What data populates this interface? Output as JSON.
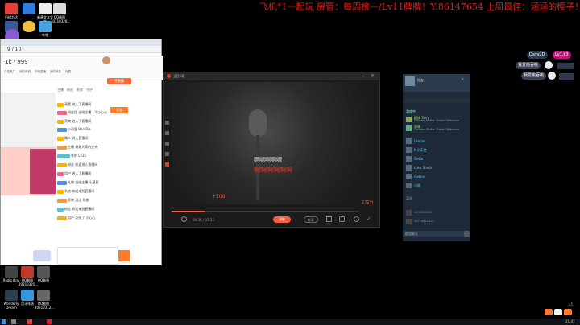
{
  "marquee": {
    "text": "飞机*1一起玩 房管：每周榜一/Lv11牌牌！Y:86147654 上周最佳：涵涵的樱子！"
  },
  "desktop_icons": [
    {
      "label": "扫描方达"
    },
    {
      "label": "新建文本文档"
    },
    {
      "label": "QQ截图 20210326..."
    },
    {
      "label": "哔哩"
    },
    {
      "label": "Radio One"
    },
    {
      "label": "QQ截图 20210325..."
    },
    {
      "label": "QQ截图"
    },
    {
      "label": "Wonderly Dream"
    },
    {
      "label": "月牙年选"
    },
    {
      "label": "QQ截图 20210312..."
    }
  ],
  "stream_app": {
    "page_counter": "9 / 10",
    "user_count": "1k / 999",
    "nav_tabs": [
      "广告推广",
      "我的商城",
      "开播直播",
      "我的消息",
      "设置"
    ],
    "live_button": "开直播",
    "chat_tabs": [
      "主播",
      "粉丝",
      "贵宾",
      "守护"
    ],
    "send_button": "发送",
    "chat_lines": [
      {
        "name": "清楚",
        "text": "进入了直播间"
      },
      {
        "name": "粉丝团",
        "text": "送给主播 1个小心心"
      },
      {
        "name": "贵宾",
        "text": "进入了直播间"
      },
      {
        "name": "小可爱",
        "text": "Bon Bia"
      },
      {
        "name": "路人",
        "text": "进入直播间"
      },
      {
        "name": "主播",
        "text": "谢谢大家的支持"
      },
      {
        "name": "守护",
        "text": "Lv15"
      },
      {
        "name": "粉丝",
        "text": "欢迎进入直播间"
      },
      {
        "name": "用户",
        "text": "进入了直播间"
      },
      {
        "name": "礼物",
        "text": "送给主播 小星星"
      },
      {
        "name": "系统",
        "text": "欢迎来到直播间"
      },
      {
        "name": "贵宾",
        "text": "送出 礼物"
      },
      {
        "name": "粉丝",
        "text": "欢迎来到直播间"
      },
      {
        "name": "用户",
        "text": "点亮了 小心心"
      }
    ]
  },
  "player": {
    "title": "全民K歌",
    "lyric_current": "啊啊啊啊啊",
    "lyric_next": "啊啊啊啊啊啊",
    "score": "+100",
    "time_elapsed": "00:36 / 03:23",
    "right_time": "271分",
    "record_button": "录制",
    "mode_button": "伴奏"
  },
  "steam": {
    "header": "好友",
    "friends_header": "游戏中",
    "friends": [
      {
        "name": "樱桃 Terry",
        "status": "Counter-Strike: Global Offensive"
      },
      {
        "name": "雨林",
        "status": "Counter-Strike: Global Offensive"
      },
      {
        "name": "Lancer",
        "status": "在线"
      },
      {
        "name": "M小天使",
        "status": "在线"
      },
      {
        "name": "GoGo",
        "status": "在线"
      },
      {
        "name": "Luke Smith",
        "status": "在线"
      },
      {
        "name": "GoBlin",
        "status": "在线"
      },
      {
        "name": "小雨",
        "status": "在线"
      }
    ],
    "offline_header": "离线",
    "ids": [
      "1235628954",
      "1871064242U"
    ],
    "group_chat": "群组聊天"
  },
  "overlay": {
    "top_user": "Days2D",
    "top_badge": "Lv1.k3",
    "rank_label_1": "我爱桃吞桃",
    "rank_label_2": "我爱桃吞桃",
    "rank_label_3": "我爱桃吞桃"
  },
  "tray": {
    "time": "21:47",
    "volume": "45"
  }
}
